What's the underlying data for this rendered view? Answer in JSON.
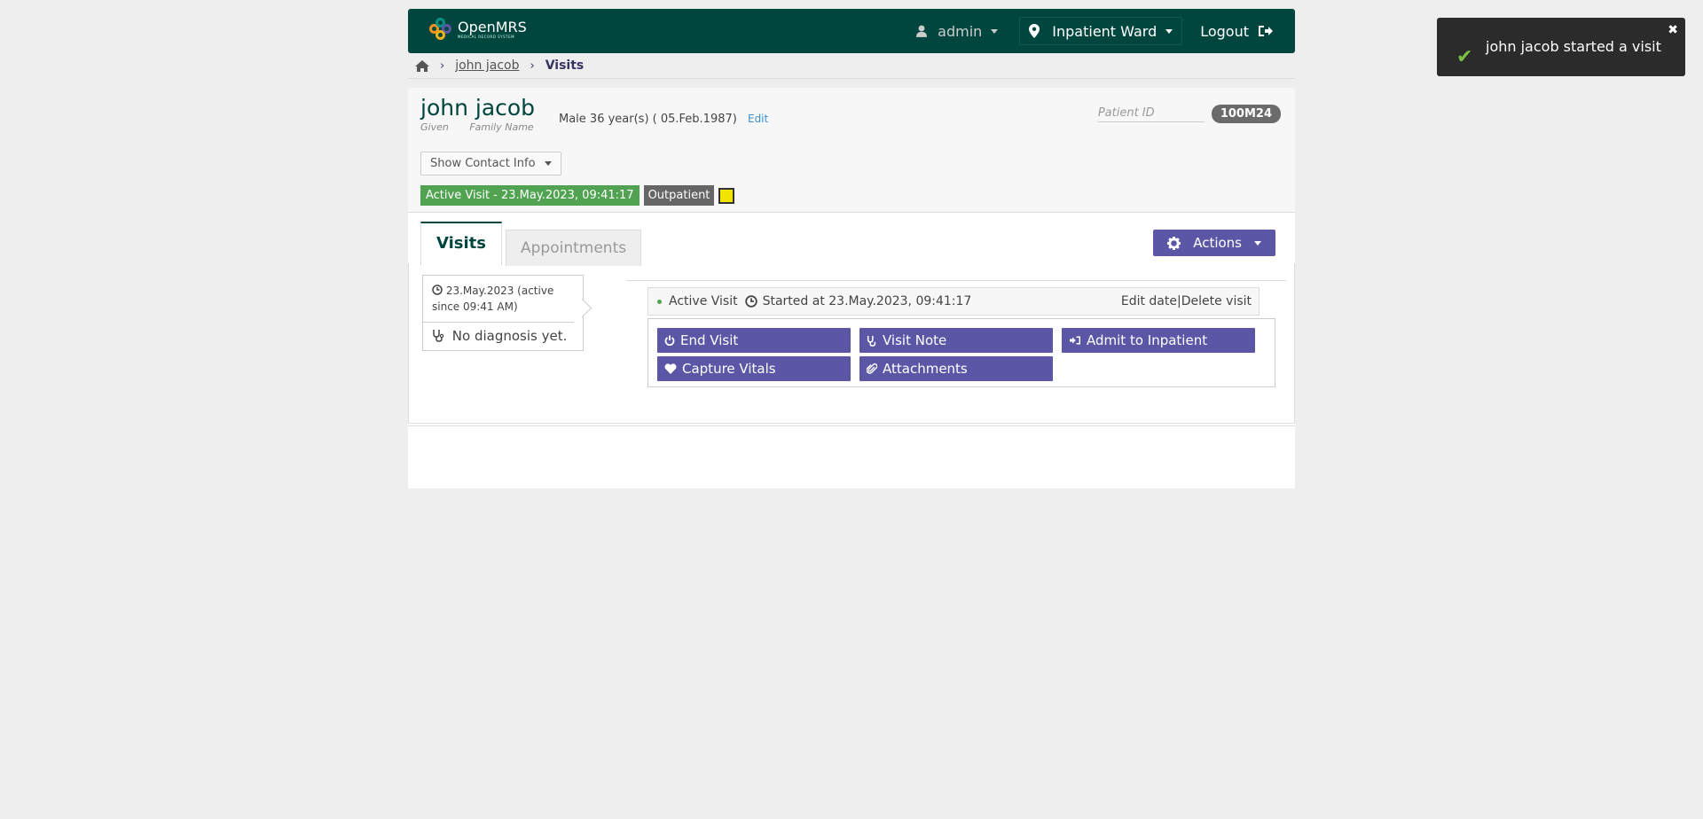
{
  "header": {
    "logo_text": "OpenMRS",
    "logo_tagline": "MEDICAL RECORD SYSTEM",
    "user": "admin",
    "location": "Inpatient Ward",
    "logout": "Logout"
  },
  "breadcrumb": {
    "patient": "john jacob",
    "current": "Visits"
  },
  "patient": {
    "name": "john jacob",
    "given_label": "Given",
    "family_label": "Family Name",
    "info": "Male  36 year(s) ( 05.Feb.1987)",
    "edit": "Edit",
    "id_label": "Patient ID",
    "id_value": "100M24",
    "contact_button": "Show Contact Info",
    "active_visit_badge": "Active Visit - 23.May.2023, 09:41:17",
    "visit_type_badge": "Outpatient"
  },
  "tabs": [
    {
      "label": "Visits"
    },
    {
      "label": "Appointments"
    }
  ],
  "actions_button": "Actions",
  "visit_card": {
    "date": "23.May.2023 (active since 09:41 AM)",
    "diagnosis": "No diagnosis yet."
  },
  "visit_detail": {
    "status": "Active Visit",
    "started": "Started at 23.May.2023, 09:41:17",
    "edit_date": "Edit date",
    "delete_visit": "Delete visit"
  },
  "visit_actions": [
    {
      "label": "End Visit",
      "icon": "power-icon"
    },
    {
      "label": "Visit Note",
      "icon": "stethoscope-icon"
    },
    {
      "label": "Admit to Inpatient",
      "icon": "sign-in-icon"
    },
    {
      "label": "Capture Vitals",
      "icon": "heart-icon"
    },
    {
      "label": "Attachments",
      "icon": "paperclip-icon"
    }
  ],
  "toast": {
    "message": "john jacob started a visit"
  },
  "colors": {
    "header_bg": "#00463f",
    "button_purple": "#5b57a6",
    "active_green": "#51a351",
    "toast_bg": "#2b2b2b"
  }
}
